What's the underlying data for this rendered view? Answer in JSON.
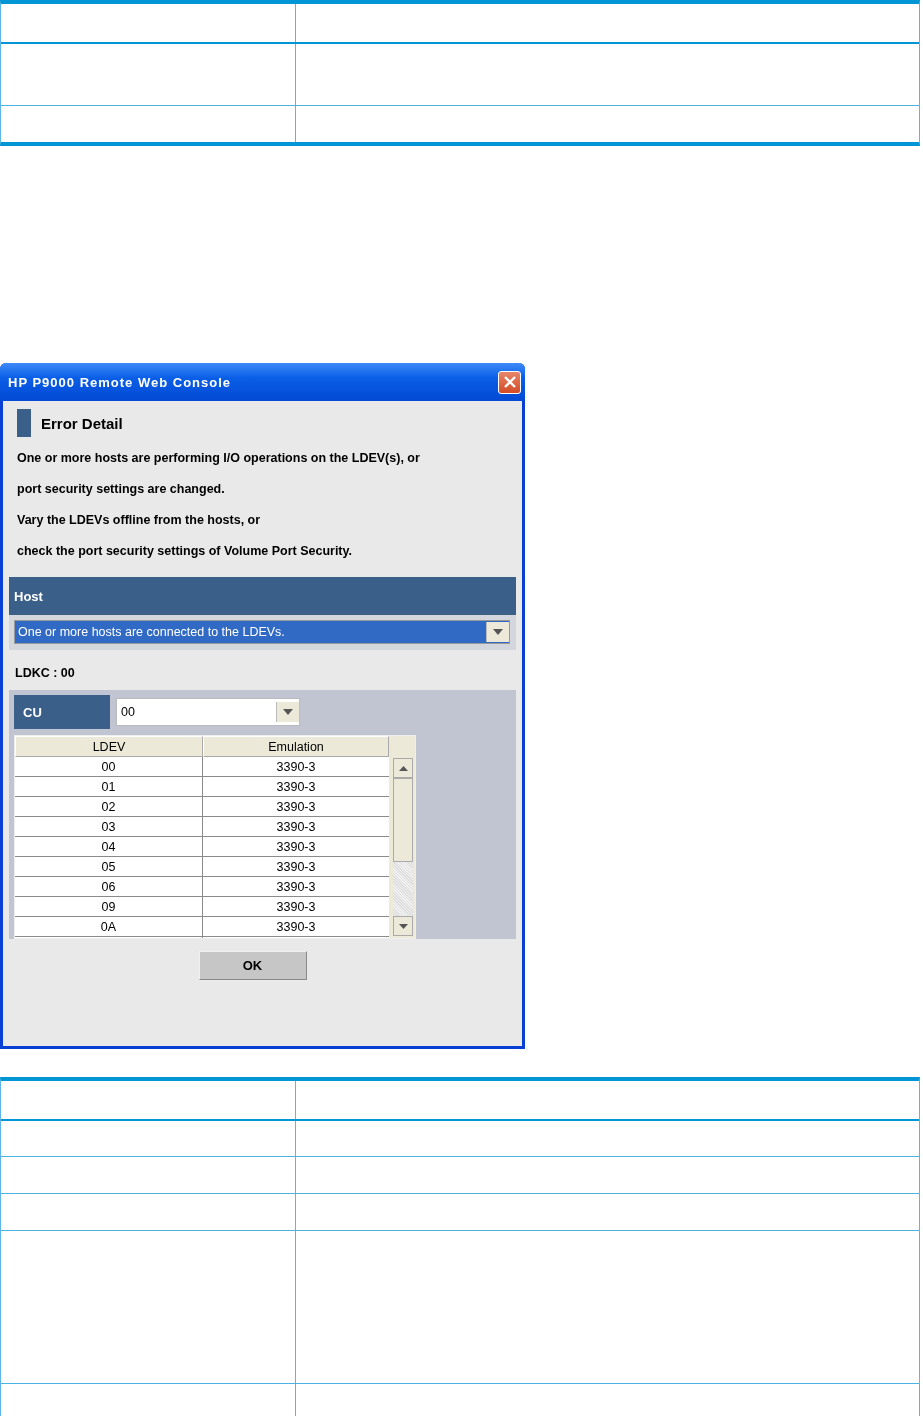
{
  "doc_tables": [
    {
      "rows": [
        {
          "kind": "header"
        },
        {
          "kind": "tall"
        },
        {
          "kind": "normal"
        }
      ]
    },
    {
      "rows": [
        {
          "kind": "header"
        },
        {
          "kind": "normal"
        },
        {
          "kind": "normal"
        },
        {
          "kind": "normal"
        },
        {
          "kind": "extra-tall"
        },
        {
          "kind": "normal"
        }
      ]
    }
  ],
  "dialog": {
    "title": "HP P9000 Remote Web Console",
    "heading": "Error Detail",
    "messages": [
      "One or more hosts are performing I/O operations on the LDEV(s), or",
      "port security settings are changed.",
      "Vary the LDEVs offline from the hosts, or",
      "check the port security settings of Volume Port Security."
    ],
    "host_label": "Host",
    "host_value": "One or more hosts are connected to the LDEVs.",
    "ldkc": "LDKC : 00",
    "cu_label": "CU",
    "cu_value": "00",
    "table": {
      "columns": [
        "LDEV",
        "Emulation"
      ],
      "rows": [
        [
          "00",
          "3390-3"
        ],
        [
          "01",
          "3390-3"
        ],
        [
          "02",
          "3390-3"
        ],
        [
          "03",
          "3390-3"
        ],
        [
          "04",
          "3390-3"
        ],
        [
          "05",
          "3390-3"
        ],
        [
          "06",
          "3390-3"
        ],
        [
          "09",
          "3390-3"
        ],
        [
          "0A",
          "3390-3"
        ]
      ]
    },
    "ok_button": "OK"
  }
}
